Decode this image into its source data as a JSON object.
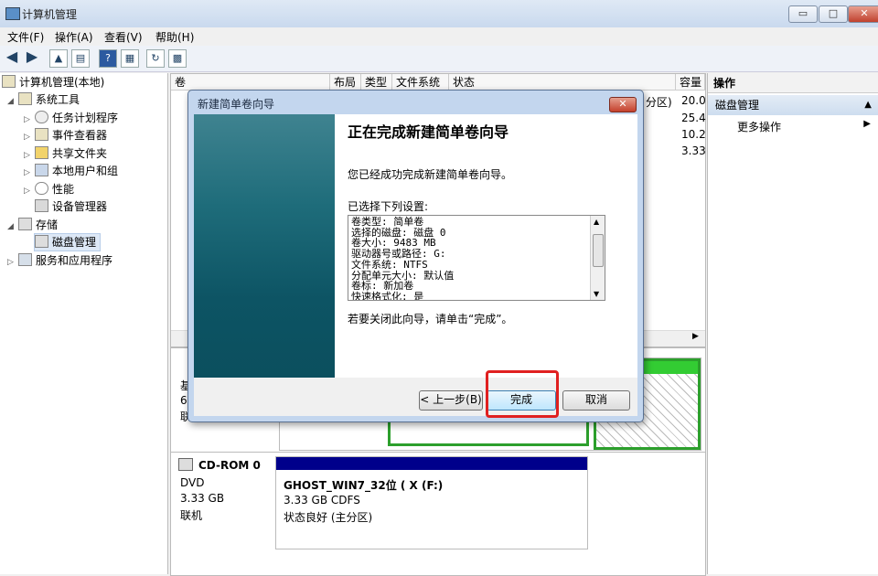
{
  "window": {
    "title": "计算机管理",
    "min": "▭",
    "max": "□",
    "close": "✕"
  },
  "menu": [
    "文件(F)",
    "操作(A)",
    "查看(V)",
    "帮助(H)"
  ],
  "tree": {
    "root": "计算机管理(本地)",
    "system_tools": "系统工具",
    "task_scheduler": "任务计划程序",
    "event_viewer": "事件查看器",
    "shared_folders": "共享文件夹",
    "local_users": "本地用户和组",
    "performance": "性能",
    "device_manager": "设备管理器",
    "storage": "存储",
    "disk_management": "磁盘管理",
    "services": "服务和应用程序"
  },
  "list": {
    "headers": {
      "vol": "卷",
      "layout": "布局",
      "type": "类型",
      "fs": "文件系统",
      "status": "状态",
      "capacity": "容量"
    },
    "status_frag": "分区)",
    "capacities": [
      "20.0",
      "25.4",
      "10.2",
      "3.33"
    ]
  },
  "disk_left": {
    "c1": "基",
    "c2": "6",
    "c3": "联"
  },
  "cdrom": {
    "name": "CD-ROM 0",
    "type": "DVD",
    "size": "3.33 GB",
    "state": "联机",
    "vol_name": "GHOST_WIN7_32位 ( X  (F:)",
    "vol_size": "3.33 GB CDFS",
    "vol_status": "状态良好 (主分区)"
  },
  "actions": {
    "header": "操作",
    "section": "磁盘管理",
    "more": "更多操作"
  },
  "wizard": {
    "title": "新建简单卷向导",
    "close": "✕",
    "heading": "正在完成新建简单卷向导",
    "done_text": "您已经成功完成新建简单卷向导。",
    "selected_label": "已选择下列设置:",
    "settings": [
      "卷类型: 简单卷",
      "选择的磁盘: 磁盘 0",
      "卷大小: 9483 MB",
      "驱动器号或路径: G:",
      "文件系统: NTFS",
      "分配单元大小: 默认值",
      "卷标: 新加卷",
      "快速格式化: 是"
    ],
    "close_tip": "若要关闭此向导，请单击“完成”。",
    "back": "< 上一步(B)",
    "finish": "完成",
    "cancel": "取消"
  }
}
